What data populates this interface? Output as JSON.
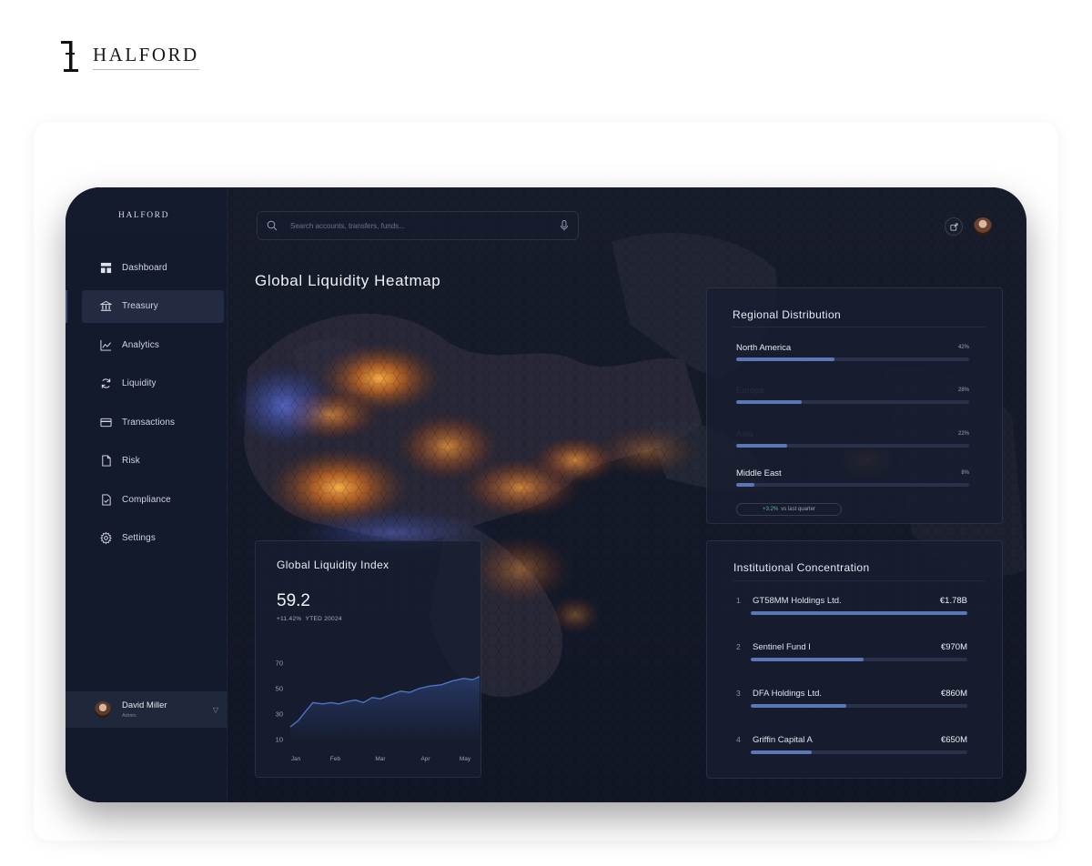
{
  "brand": {
    "name": "HALFORD",
    "mark": "halford-monogram"
  },
  "sidebar": {
    "logo": "HALFORD",
    "items": [
      {
        "label": "Dashboard",
        "icon": "dashboard-icon",
        "active": false
      },
      {
        "label": "Treasury",
        "icon": "bank-icon",
        "active": true
      },
      {
        "label": "Analytics",
        "icon": "chart-icon",
        "active": false
      },
      {
        "label": "Liquidity",
        "icon": "refresh-icon",
        "active": false
      },
      {
        "label": "Transactions",
        "icon": "card-icon",
        "active": false
      },
      {
        "label": "Risk",
        "icon": "document-icon",
        "active": false
      },
      {
        "label": "Compliance",
        "icon": "document-check-icon",
        "active": false
      },
      {
        "label": "Settings",
        "icon": "gear-icon",
        "active": false
      }
    ],
    "user": {
      "name": "David Miller",
      "role": "Admin"
    }
  },
  "search": {
    "placeholder": "Search accounts, transfers, funds..."
  },
  "header": {
    "title": "Global Liquidity Heatmap"
  },
  "regional": {
    "title": "Regional Distribution",
    "rows": [
      {
        "name": "North America",
        "pct_label": "42%",
        "pct": 42,
        "name_visible": true
      },
      {
        "name": "Europe",
        "pct_label": "28%",
        "pct": 28,
        "name_visible": false
      },
      {
        "name": "Asia",
        "pct_label": "22%",
        "pct": 22,
        "name_visible": false
      },
      {
        "name": "Middle East",
        "pct_label": "8%",
        "pct": 8,
        "name_visible": true
      }
    ],
    "change": {
      "value": "+3.2%",
      "text": "vs last quarter"
    }
  },
  "institutional": {
    "title": "Institutional Concentration",
    "rows": [
      {
        "rank": "1",
        "name": "GT58MM Holdings Ltd.",
        "value": "€1.78B",
        "share": 1.0
      },
      {
        "rank": "2",
        "name": "Sentinel Fund I",
        "value": "€970M",
        "share": 0.52
      },
      {
        "rank": "3",
        "name": "DFA Holdings Ltd.",
        "value": "€860M",
        "share": 0.44
      },
      {
        "rank": "4",
        "name": "Griffin Capital A",
        "value": "€650M",
        "share": 0.28
      }
    ]
  },
  "index": {
    "title": "Global Liquidity Index",
    "value": "59.2",
    "change": "+11.42%",
    "period": "YTED 20024"
  },
  "chart_data": {
    "type": "area",
    "x": [
      "Jan",
      "Feb",
      "Mar",
      "Apr",
      "May"
    ],
    "yticks": [
      10,
      30,
      50,
      70
    ],
    "ylim": [
      10,
      70
    ],
    "grid": false,
    "points": [
      {
        "x": 0,
        "y": 20
      },
      {
        "x": 0.18,
        "y": 25
      },
      {
        "x": 0.36,
        "y": 33
      },
      {
        "x": 0.5,
        "y": 39
      },
      {
        "x": 0.72,
        "y": 38
      },
      {
        "x": 0.9,
        "y": 39
      },
      {
        "x": 1.08,
        "y": 38
      },
      {
        "x": 1.28,
        "y": 40
      },
      {
        "x": 1.45,
        "y": 41
      },
      {
        "x": 1.62,
        "y": 39
      },
      {
        "x": 1.82,
        "y": 43
      },
      {
        "x": 2.0,
        "y": 42
      },
      {
        "x": 2.22,
        "y": 45
      },
      {
        "x": 2.45,
        "y": 48
      },
      {
        "x": 2.65,
        "y": 47
      },
      {
        "x": 2.85,
        "y": 50
      },
      {
        "x": 3.1,
        "y": 52
      },
      {
        "x": 3.35,
        "y": 53
      },
      {
        "x": 3.6,
        "y": 56
      },
      {
        "x": 3.85,
        "y": 58
      },
      {
        "x": 4.05,
        "y": 57
      },
      {
        "x": 4.3,
        "y": 61
      },
      {
        "x": 4.45,
        "y": 63
      }
    ],
    "colors": {
      "line": "#4f74c4",
      "area_top": "#3b5ba8",
      "marker": "#7ea4ee"
    }
  },
  "top_icons": [
    "share-icon",
    "avatar"
  ],
  "colors": {
    "accent": "#5a78b8",
    "panel": "#181e2f",
    "positive": "#4fc08d"
  }
}
